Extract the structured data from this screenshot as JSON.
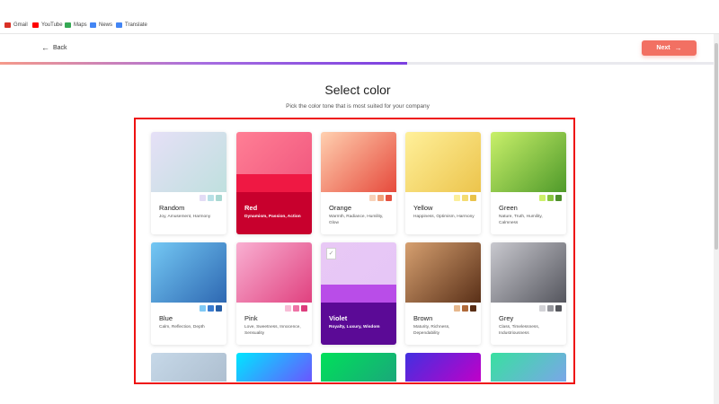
{
  "bookmarks": [
    {
      "label": "Gmail",
      "icon": "gmail-icon",
      "color": "#d93025"
    },
    {
      "label": "YouTube",
      "icon": "youtube-icon",
      "color": "#ff0000"
    },
    {
      "label": "Maps",
      "icon": "maps-icon",
      "color": "#34a853"
    },
    {
      "label": "News",
      "icon": "news-icon",
      "color": "#4285f4"
    },
    {
      "label": "Translate",
      "icon": "translate-icon",
      "color": "#4285f4"
    }
  ],
  "header": {
    "back_label": "Back",
    "next_label": "Next",
    "progress_fraction": 0.57
  },
  "page": {
    "title": "Select color",
    "subtitle": "Pick the color tone that is most suited for your company"
  },
  "colors": [
    {
      "name": "Random",
      "desc": "Joy, Amusement, Harmony",
      "gradient": [
        "#e6e0f7",
        "#bfe0de"
      ],
      "dots": [
        "#e3dcf5",
        "#b8e0e6",
        "#a9d8d2"
      ],
      "selected": false
    },
    {
      "name": "Red",
      "desc": "Dynamism, Passion, Action",
      "gradient": [
        "#ff7f95",
        "#f25a80"
      ],
      "dots": [],
      "selected": true,
      "band": "#ef1843",
      "panel": "#c8002d"
    },
    {
      "name": "Orange",
      "desc": "Warmth, Radiance, Humility, Glow",
      "gradient": [
        "#ffd0b0",
        "#e64a3c"
      ],
      "dots": [
        "#f8d2b8",
        "#f1a27a",
        "#e4503f"
      ],
      "selected": false
    },
    {
      "name": "Yellow",
      "desc": "Happiness, Optimism, Harmony",
      "gradient": [
        "#fff09a",
        "#ecc44c"
      ],
      "dots": [
        "#fbee9a",
        "#f4dc72",
        "#e9c24a"
      ],
      "selected": false
    },
    {
      "name": "Green",
      "desc": "Nature, Truth, Humility, Calmness",
      "gradient": [
        "#c9f06a",
        "#4f9a2a"
      ],
      "dots": [
        "#cdf06a",
        "#88c540",
        "#4d8e2a"
      ],
      "selected": false
    },
    {
      "name": "Blue",
      "desc": "Calm, Reflection, Depth",
      "gradient": [
        "#74c8f4",
        "#2e68b2"
      ],
      "dots": [
        "#7fc9f5",
        "#3a7cd0",
        "#275ea6"
      ],
      "selected": false
    },
    {
      "name": "Pink",
      "desc": "Love, Sweetness, Innocence, Sensuality",
      "gradient": [
        "#f9b0d2",
        "#e0417f"
      ],
      "dots": [
        "#f8bcd6",
        "#ee73a6",
        "#dd3d7d"
      ],
      "selected": false
    },
    {
      "name": "Violet",
      "desc": "Royalty, Luxury, Wisdom",
      "gradient": [
        "#e8c8f5",
        "#e6c6f6"
      ],
      "dots": [],
      "selected": true,
      "band": "#b94de8",
      "panel": "#5b0a96"
    },
    {
      "name": "Brown",
      "desc": "Maturity, Richness, Dependability",
      "gradient": [
        "#d6a070",
        "#5a3018"
      ],
      "dots": [
        "#e6b78d",
        "#b06a3a",
        "#5a2e15"
      ],
      "selected": false
    },
    {
      "name": "Grey",
      "desc": "Class, Timelessness, Industriousness",
      "gradient": [
        "#c9c9cf",
        "#55565e"
      ],
      "dots": [
        "#d2d2d6",
        "#96979d",
        "#55565c"
      ],
      "selected": false
    }
  ],
  "partial_row": [
    [
      "#c6d8e8",
      "#aebfd0"
    ],
    [
      "#00e6ff",
      "#6a55ff"
    ],
    [
      "#00e05a",
      "#1aa87a"
    ],
    [
      "#4230e0",
      "#c000c8"
    ],
    [
      "#38e0a0",
      "#7aa6e8"
    ]
  ]
}
